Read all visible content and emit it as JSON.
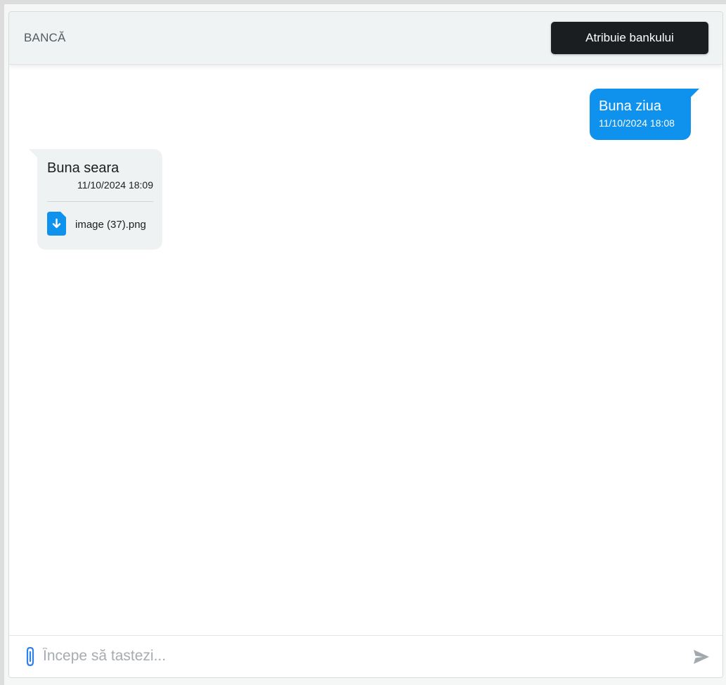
{
  "header": {
    "title": "BANCĂ",
    "assign_button_label": "Atribuie bankului"
  },
  "messages": [
    {
      "direction": "outgoing",
      "text": "Buna ziua",
      "time": "11/10/2024 18:08"
    },
    {
      "direction": "incoming",
      "text": "Buna seara",
      "time": "11/10/2024 18:09",
      "attachment": {
        "name": "image (37).png",
        "icon": "file-download-icon"
      }
    }
  ],
  "composer": {
    "placeholder": "Începe să tastezi...",
    "value": "",
    "attach_icon": "paperclip-icon",
    "send_icon": "send-icon"
  },
  "colors": {
    "accent": "#0f92ee",
    "header_bg": "#eff3f4",
    "button_bg": "#1b1e21",
    "incoming_bubble": "#eff2f3"
  }
}
